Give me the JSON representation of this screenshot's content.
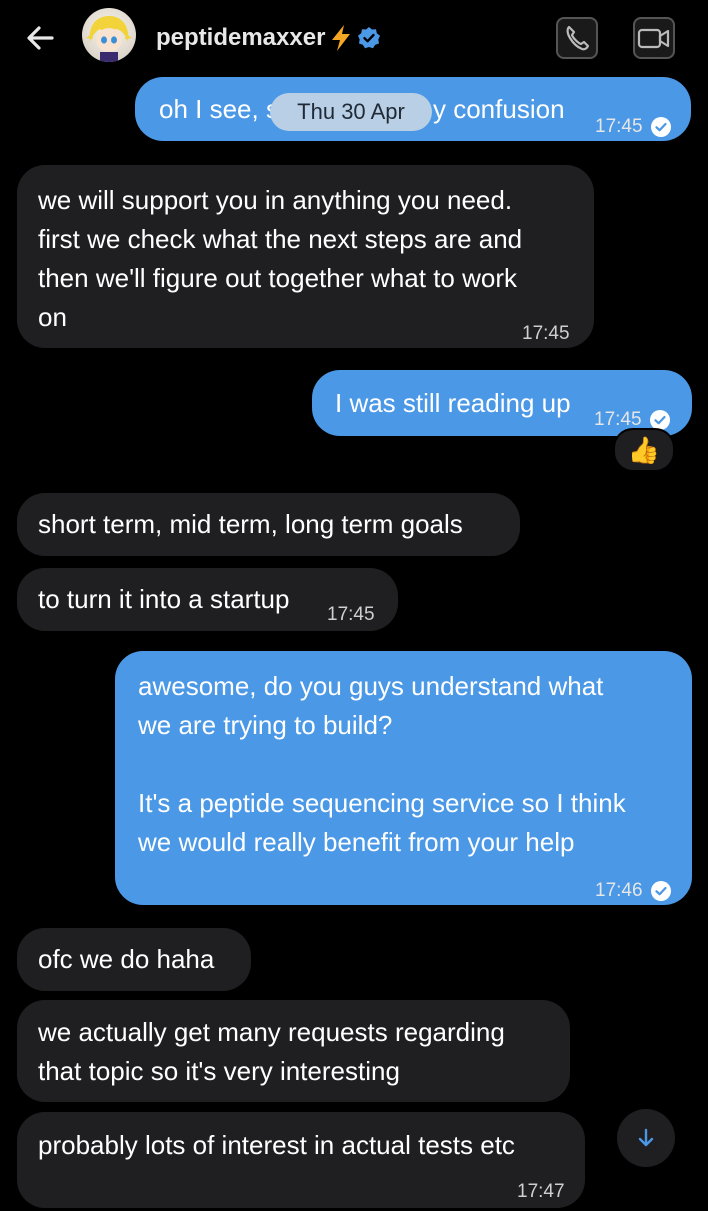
{
  "header": {
    "contact_name": "peptidemaxxer",
    "back_icon": "arrow-left-icon",
    "name_emoji_icon": "lightning-icon",
    "verified_icon": "verified-badge-icon",
    "call_icon": "phone-icon",
    "video_icon": "video-camera-icon"
  },
  "date_separator": "Thu 30 Apr",
  "messages": [
    {
      "from": "me",
      "line_before": "oh I see, s",
      "line_after": "y confusion",
      "time": "17:45",
      "read": true
    },
    {
      "from": "them",
      "lines": [
        "we will support you in anything you need.",
        "first we check what the next steps are and",
        "then we'll figure out together what to work",
        "on"
      ],
      "time": "17:45"
    },
    {
      "from": "me",
      "text": "I was still reading up",
      "time": "17:45",
      "read": true,
      "reaction": "👍"
    },
    {
      "from": "them",
      "text": "short term, mid term, long term goals"
    },
    {
      "from": "them",
      "text": "to turn it into a startup",
      "time": "17:45"
    },
    {
      "from": "me",
      "lines": [
        "awesome, do you guys understand what",
        "we are trying to build?",
        "",
        "It's a peptide sequencing service so I think",
        "we would really benefit from your help"
      ],
      "time": "17:46",
      "read": true
    },
    {
      "from": "them",
      "text": "ofc we do haha"
    },
    {
      "from": "them",
      "lines": [
        "we actually get many requests regarding",
        "that topic so it's very interesting"
      ]
    },
    {
      "from": "them",
      "text": "probably lots of interest in actual tests etc",
      "time": "17:47"
    }
  ],
  "scroll_down_icon": "arrow-down-icon",
  "colors": {
    "background": "#000000",
    "incoming_bubble": "#1f1f21",
    "outgoing_bubble": "#4a98e6",
    "verified": "#4a98e6",
    "date_pill": "#b9cfe6"
  }
}
